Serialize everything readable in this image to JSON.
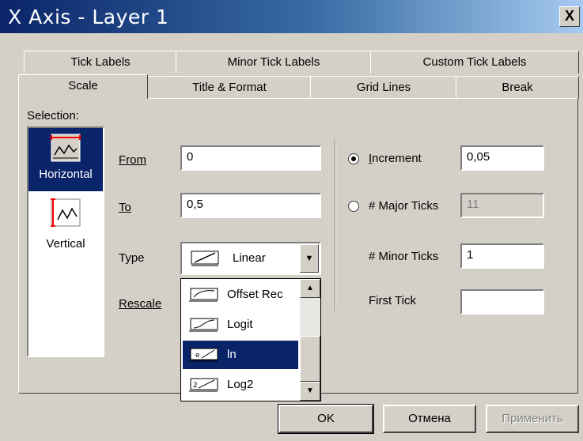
{
  "window": {
    "title": "X Axis - Layer 1",
    "close_label": "X"
  },
  "tabs_row1": [
    {
      "label": "Tick Labels"
    },
    {
      "label": "Minor Tick Labels"
    },
    {
      "label": "Custom Tick Labels"
    }
  ],
  "tabs_row2": [
    {
      "label": "Scale",
      "active": true
    },
    {
      "label": "Title & Format"
    },
    {
      "label": "Grid Lines"
    },
    {
      "label": "Break"
    }
  ],
  "selection": {
    "label": "Selection:",
    "items": [
      {
        "label": "Horizontal",
        "selected": true,
        "icon": "horizontal-axis-icon"
      },
      {
        "label": "Vertical",
        "selected": false,
        "icon": "vertical-axis-icon"
      }
    ]
  },
  "scale": {
    "from_label": "From",
    "from_value": "0",
    "to_label": "To",
    "to_value": "0,5",
    "type_label": "Type",
    "type_value": "Linear",
    "rescale_label": "Rescale"
  },
  "type_options": [
    {
      "label": "Offset Rec",
      "selected": false
    },
    {
      "label": "Logit",
      "selected": false
    },
    {
      "label": "ln",
      "selected": true
    },
    {
      "label": "Log2",
      "selected": false
    }
  ],
  "ticks": {
    "increment_label": "Increment",
    "increment_value": "0,05",
    "increment_checked": true,
    "major_label": "# Major Ticks",
    "major_value": "11",
    "major_checked": false,
    "minor_label": "# Minor Ticks",
    "minor_value": "1",
    "first_label": "First Tick",
    "first_value": ""
  },
  "buttons": {
    "ok": "OK",
    "cancel": "Отмена",
    "apply": "Применить"
  }
}
